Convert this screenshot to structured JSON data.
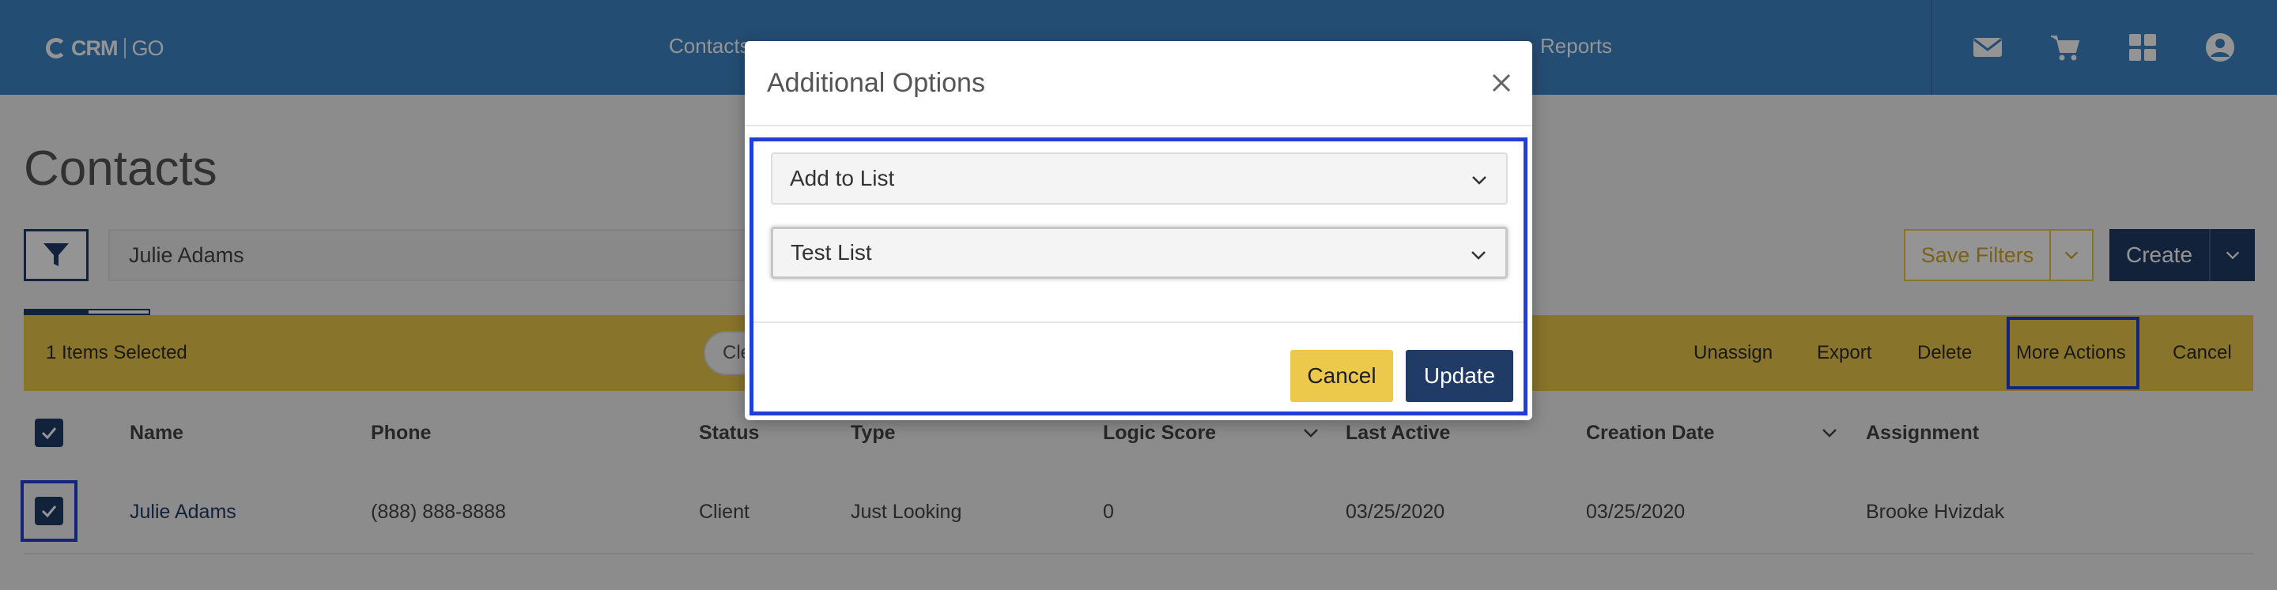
{
  "app": {
    "logo_primary": "CRM",
    "logo_secondary": "GO"
  },
  "nav": {
    "items": [
      "Contacts",
      "Reports"
    ],
    "icons": [
      "mail-icon",
      "cart-icon",
      "grid-icon",
      "account-icon"
    ]
  },
  "page": {
    "title": "Contacts"
  },
  "search": {
    "value": "Julie Adams"
  },
  "toolbar": {
    "save_filters_label": "Save Filters",
    "create_label": "Create"
  },
  "selection_bar": {
    "count_text": "1 Items Selected",
    "clear_label": "Cle",
    "actions": [
      "Unassign",
      "Export",
      "Delete",
      "More Actions",
      "Cancel"
    ]
  },
  "table": {
    "columns": [
      "Name",
      "Phone",
      "Status",
      "Type",
      "Logic Score",
      "Last Active",
      "Creation Date",
      "Assignment"
    ],
    "rows": [
      {
        "name": "Julie Adams",
        "phone": "(888) 888-8888",
        "status": "Client",
        "type": "Just Looking",
        "logic_score": "0",
        "last_active": "03/25/2020",
        "creation_date": "03/25/2020",
        "assignment": "Brooke Hvizdak"
      }
    ]
  },
  "modal": {
    "title": "Additional Options",
    "action_select_value": "Add to List",
    "list_select_value": "Test List",
    "cancel_label": "Cancel",
    "update_label": "Update"
  },
  "colors": {
    "nav_bg": "#3f86c8",
    "primary": "#1f3b66",
    "accent_yellow": "#ecc94b",
    "highlight_blue": "#1f3fd6"
  }
}
